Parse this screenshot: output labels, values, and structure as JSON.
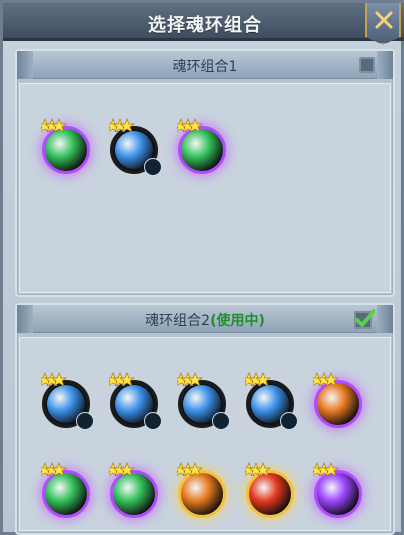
{
  "dialog": {
    "title": "选择魂环组合",
    "close_icon": "close-icon"
  },
  "groups": [
    {
      "title": "魂环组合1",
      "status": "",
      "checked": false,
      "rings": [
        {
          "icon": "green-leaf-soul-ring-icon",
          "theme": "green",
          "glow": "purple",
          "stars": 3,
          "badge": false
        },
        {
          "icon": "dark-blade-soul-ring-icon",
          "theme": "blue",
          "glow": "none",
          "stars": 3,
          "badge": true
        },
        {
          "icon": "green-sprout-soul-ring-icon",
          "theme": "green",
          "glow": "purple",
          "stars": 3,
          "badge": false
        }
      ]
    },
    {
      "title": "魂环组合2",
      "status": "(使用中)",
      "checked": true,
      "rings": [
        {
          "icon": "water-swirl-soul-ring-icon",
          "theme": "blue",
          "glow": "none",
          "stars": 3,
          "badge": true
        },
        {
          "icon": "blue-beast-soul-ring-icon",
          "theme": "blue",
          "glow": "none",
          "stars": 3,
          "badge": true
        },
        {
          "icon": "dark-blade-soul-ring-icon",
          "theme": "blue",
          "glow": "none",
          "stars": 3,
          "badge": true
        },
        {
          "icon": "blue-dragon-soul-ring-icon",
          "theme": "blue",
          "glow": "none",
          "stars": 3,
          "badge": true
        },
        {
          "icon": "fire-swirl-soul-ring-icon",
          "theme": "orange",
          "glow": "purple",
          "stars": 3,
          "badge": false
        },
        {
          "icon": "green-sprout-soul-ring-icon",
          "theme": "green",
          "glow": "purple",
          "stars": 3,
          "badge": false
        },
        {
          "icon": "green-leaf-soul-ring-icon",
          "theme": "green",
          "glow": "purple",
          "stars": 3,
          "badge": false
        },
        {
          "icon": "sun-swirl-soul-ring-icon",
          "theme": "orange",
          "glow": "yellow",
          "stars": 3,
          "badge": false
        },
        {
          "icon": "flame-beast-soul-ring-icon",
          "theme": "red",
          "glow": "yellow",
          "stars": 3,
          "badge": false
        },
        {
          "icon": "purple-flame-soul-ring-icon",
          "theme": "purple",
          "glow": "purple",
          "stars": 3,
          "badge": false
        }
      ]
    }
  ],
  "colors": {
    "green": "#35c15a",
    "blue": "#3b8fe8",
    "orange": "#e67a1f",
    "red": "#e33a1f",
    "purple": "#9c45ff"
  }
}
